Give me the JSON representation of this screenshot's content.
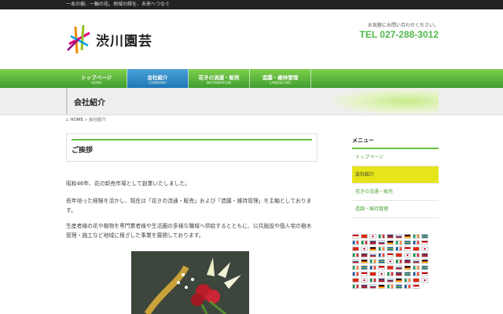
{
  "topbar": {
    "tagline": "一本の樹、一輪の花。地域の緑を、未来へつなぐ"
  },
  "logo": {
    "text": "渋川園芸"
  },
  "contact": {
    "message": "お気軽にお問い合わせください。",
    "tel": "TEL 027-288-3012"
  },
  "nav": {
    "items": [
      {
        "jp": "トップページ",
        "en": "HOME"
      },
      {
        "jp": "会社紹介",
        "en": "COMPANY"
      },
      {
        "jp": "花きの流通・販売",
        "en": "INFORMATION"
      },
      {
        "jp": "造園・維持管理",
        "en": "LANDSCAPE"
      }
    ]
  },
  "page": {
    "title": "会社紹介"
  },
  "breadcrumb": {
    "home": "HOME",
    "separator": "»",
    "current": "会社紹介"
  },
  "main": {
    "heading": "ご挨拶",
    "p1": "昭和46年、花の卸売市場として創業いたしました。",
    "p2": "長年培った経験を活かし、現在は「花きの流通・販売」および「造園・維持管理」を主軸としております。",
    "p3": "生産者様の花や植物を専門業者様や生活圏の多様な職域へ供給するとともに、公共施設や個人宅の樹木管理・施工など地域に根ざした事業を展開しております。"
  },
  "sidebar": {
    "title": "メニュー",
    "items": [
      {
        "label": "トップページ"
      },
      {
        "label": "会社紹介"
      },
      {
        "label": "花きの流通・販売"
      },
      {
        "label": "造園・維持管理"
      }
    ]
  },
  "colors": {
    "accent": "#64c043",
    "nav_active": "#2a86c6",
    "tel": "#4fb84a",
    "side_active": "#e6e41a"
  }
}
